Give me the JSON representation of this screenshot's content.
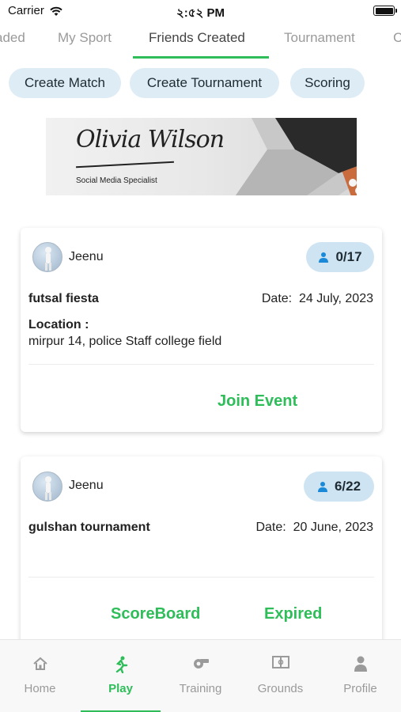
{
  "status_bar": {
    "carrier": "Carrier",
    "time": "২:৫২ PM"
  },
  "tabs": [
    {
      "label": "aded",
      "active": false
    },
    {
      "label": "My Sport",
      "active": false
    },
    {
      "label": "Friends Created",
      "active": true
    },
    {
      "label": "Tournament",
      "active": false
    },
    {
      "label": "C",
      "active": false
    }
  ],
  "actions": {
    "create_match": "Create Match",
    "create_tournament": "Create Tournament",
    "scoring": "Scoring"
  },
  "banner": {
    "signature": "Olivia Wilson",
    "subtitle": "Social Media Specialist"
  },
  "events": [
    {
      "owner": "Jeenu",
      "players": "0/17",
      "name": "futsal fiesta",
      "date_label": "Date:",
      "date": "24 July, 2023",
      "location_label": "Location :",
      "location": "mirpur 14, police Staff college field",
      "action": "Join Event"
    },
    {
      "owner": "Jeenu",
      "players": "6/22",
      "name": "gulshan tournament",
      "date_label": "Date:",
      "date": "20 June, 2023",
      "scoreboard": "ScoreBoard",
      "status": "Expired"
    }
  ],
  "bottom_nav": [
    {
      "label": "Home",
      "icon": "home-icon",
      "active": false
    },
    {
      "label": "Play",
      "icon": "running-icon",
      "active": true
    },
    {
      "label": "Training",
      "icon": "whistle-icon",
      "active": false
    },
    {
      "label": "Grounds",
      "icon": "field-icon",
      "active": false
    },
    {
      "label": "Profile",
      "icon": "person-icon",
      "active": false
    }
  ],
  "colors": {
    "accent": "#2ebd59",
    "chip_bg": "#deecf5",
    "badge_bg": "#cfe4f3",
    "inactive": "#9a9a9a"
  }
}
